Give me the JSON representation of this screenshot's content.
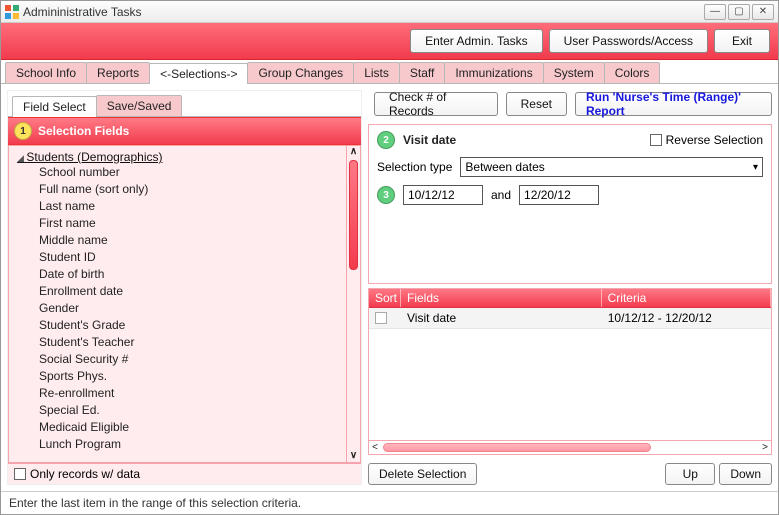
{
  "window": {
    "title": "Admininistrative Tasks"
  },
  "topbar": {
    "enter_admin": "Enter Admin. Tasks",
    "user_pw": "User Passwords/Access",
    "exit": "Exit"
  },
  "main_tabs": [
    "School Info",
    "Reports",
    "<-Selections->",
    "Group Changes",
    "Lists",
    "Staff",
    "Immunizations",
    "System",
    "Colors"
  ],
  "main_tabs_active_index": 2,
  "left": {
    "sub_tabs": [
      "Field Select",
      "Save/Saved"
    ],
    "sub_tabs_active_index": 0,
    "badge": "1",
    "section_title": "Selection Fields",
    "group": "Students (Demographics)",
    "items": [
      "School number",
      "Full name (sort only)",
      "Last name",
      "First name",
      "Middle name",
      "Student ID",
      "Date of birth",
      "Enrollment date",
      "Gender",
      "Student's Grade",
      "Student's Teacher",
      "Social Security #",
      "Sports Phys.",
      "Re-enrollment",
      "Special Ed.",
      "Medicaid Eligible",
      "Lunch Program"
    ],
    "only_records": "Only records w/ data"
  },
  "right": {
    "check_records": "Check # of Records",
    "reset": "Reset",
    "run_report": "Run 'Nurse's Time (Range)' Report",
    "step2_badge": "2",
    "step2_label": "Visit date",
    "reverse_label": "Reverse Selection",
    "sel_type_label": "Selection type",
    "sel_type_value": "Between dates",
    "step3_badge": "3",
    "date_from": "10/12/12",
    "and_label": "and",
    "date_to": "12/20/12",
    "columns": {
      "sort": "Sort",
      "fields": "Fields",
      "criteria": "Criteria"
    },
    "rows": [
      {
        "field": "Visit date",
        "criteria": "10/12/12 - 12/20/12"
      }
    ],
    "delete_sel": "Delete Selection",
    "up": "Up",
    "down": "Down"
  },
  "status": "Enter the last item in the range of this selection criteria."
}
